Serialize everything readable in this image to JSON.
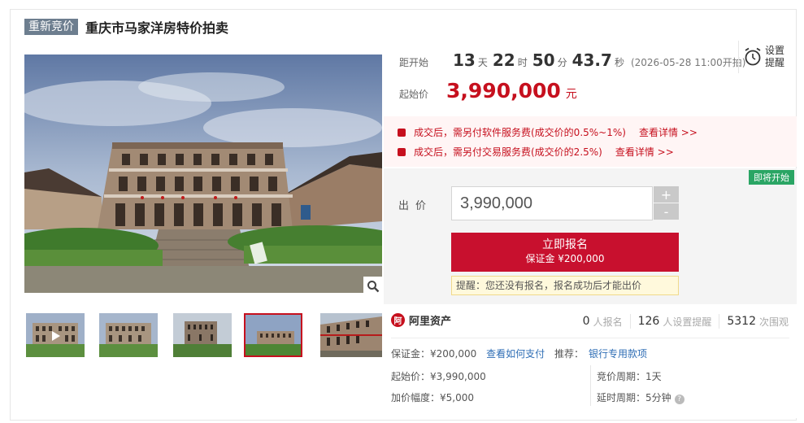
{
  "header": {
    "badge": "重新竞价",
    "title": "重庆市马家洋房特价拍卖"
  },
  "countdown": {
    "label": "距开始",
    "days": "13",
    "days_unit": "天",
    "hours": "22",
    "hours_unit": "时",
    "minutes": "50",
    "minutes_unit": "分",
    "seconds": "43.7",
    "seconds_unit": "秒",
    "start_note": "(2026-05-28 11:00开拍)"
  },
  "start_price": {
    "label": "起始价",
    "value": "3,990,000",
    "unit": "元"
  },
  "remind": {
    "line1": "设置",
    "line2": "提醒",
    "icon": "alarm-clock-icon"
  },
  "fees": [
    {
      "text": "成交后，需另付软件服务费(成交价的0.5%~1%)",
      "link": "查看详情 >>"
    },
    {
      "text": "成交后，需另付交易服务费(成交价的2.5%)",
      "link": "查看详情 >>"
    }
  ],
  "bid": {
    "status_tag": "即将开始",
    "label": "出价",
    "input_value": "3,990,000",
    "plus": "+",
    "minus": "-",
    "signup_main": "立即报名",
    "signup_sub": "保证金 ¥200,000",
    "tip": "提醒：您还没有报名，报名成功后才能出价"
  },
  "platform": {
    "logo_glyph": "阿",
    "name": "阿里资产"
  },
  "stats": [
    {
      "num": "0",
      "label": "人报名"
    },
    {
      "num": "126",
      "label": "人设置提醒"
    },
    {
      "num": "5312",
      "label": "次围观"
    }
  ],
  "details": {
    "deposit_label": "保证金：",
    "deposit_value": "¥200,000",
    "pay_link": "查看如何支付",
    "recommend_label": "推荐：",
    "recommend_link": "银行专用款项",
    "start_price_label": "起始价：",
    "start_price_value": "¥3,990,000",
    "increment_label": "加价幅度：",
    "increment_value": "¥5,000",
    "cycle_label": "竞价周期：",
    "cycle_value": "1天",
    "delay_label": "延时周期：",
    "delay_value": "5分钟"
  },
  "colors": {
    "accent": "#c6101e",
    "badge": "#6d7e8f",
    "status_green": "#2aa564",
    "link": "#2f6eb5"
  }
}
